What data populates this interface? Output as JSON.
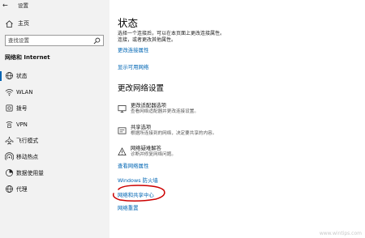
{
  "titlebar": {
    "back_glyph": "←",
    "title": "设置"
  },
  "sidebar": {
    "home_label": "主页",
    "search_placeholder": "查找设置",
    "section_label": "网络和 Internet",
    "items": [
      {
        "label": "状态",
        "icon": "globe-icon",
        "active": true
      },
      {
        "label": "WLAN",
        "icon": "wifi-icon",
        "active": false
      },
      {
        "label": "拨号",
        "icon": "dialup-phone-icon",
        "active": false
      },
      {
        "label": "VPN",
        "icon": "vpn-icon",
        "active": false
      },
      {
        "label": "飞行模式",
        "icon": "airplane-icon",
        "active": false
      },
      {
        "label": "移动热点",
        "icon": "mobile-hotspot-icon",
        "active": false
      },
      {
        "label": "数据使用量",
        "icon": "data-usage-icon",
        "active": false
      },
      {
        "label": "代理",
        "icon": "proxy-globe-icon",
        "active": false
      }
    ]
  },
  "main": {
    "title": "状态",
    "description": "选择一个连接后，可以在本页面上更改连接属性。",
    "description_line2": "连接，或者更改其他属性。",
    "links_top": {
      "change_connection_properties": "更改连接属性",
      "show_available_networks": "显示可用网络"
    },
    "section_title": "更改网络设置",
    "options": [
      {
        "title": "更改适配器选项",
        "desc": "查看网络适配器并更改连接设置。",
        "icon": "adapter-icon"
      },
      {
        "title": "共享选项",
        "desc": "根据所连接到的网络，决定要共享的内容。",
        "icon": "sharing-icon"
      },
      {
        "title": "网络疑难解答",
        "desc": "诊断并修复网络问题。",
        "icon": "warning-icon"
      }
    ],
    "links_bottom": {
      "view_network_properties": "查看网络属性",
      "windows_firewall": "Windows 防火墙",
      "network_sharing_center": "网络和共享中心",
      "network_reset": "网络重置"
    }
  },
  "colors": {
    "sidebar_bg": "#f2f2f2",
    "link": "#0066b4",
    "accent": "#0063b1",
    "annotation": "#cc0000"
  },
  "watermark": "www.wintips.com"
}
